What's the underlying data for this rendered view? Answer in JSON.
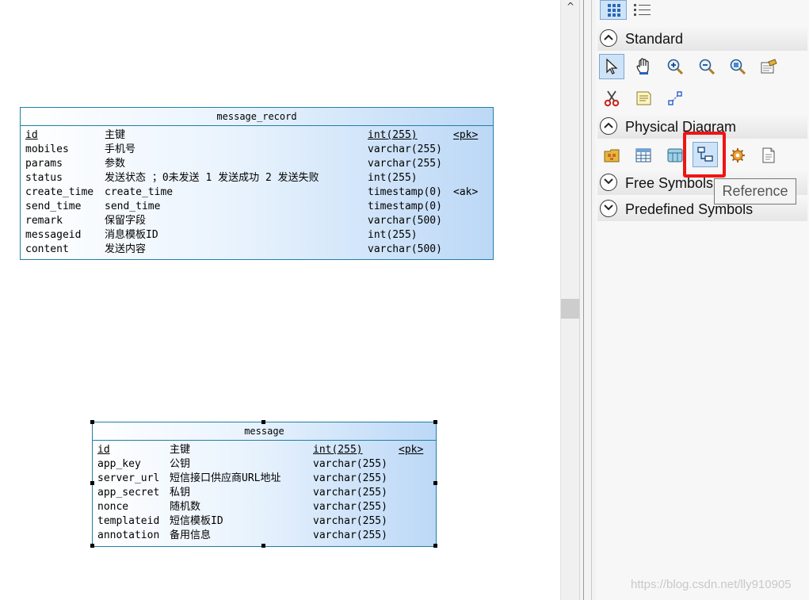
{
  "entities": {
    "message_record": {
      "title": "message_record",
      "rows": [
        {
          "name": "id",
          "comment": "主键",
          "type": "int(255)",
          "key": "<pk>"
        },
        {
          "name": "mobiles",
          "comment": "手机号",
          "type": "varchar(255)",
          "key": ""
        },
        {
          "name": "params",
          "comment": "参数",
          "type": "varchar(255)",
          "key": ""
        },
        {
          "name": "status",
          "comment": "发送状态 ；0未发送 1 发送成功 2 发送失败",
          "type": "int(255)",
          "key": ""
        },
        {
          "name": "create_time",
          "comment": "create_time",
          "type": "timestamp(0)",
          "key": "<ak>"
        },
        {
          "name": "send_time",
          "comment": "send_time",
          "type": "timestamp(0)",
          "key": ""
        },
        {
          "name": "remark",
          "comment": "保留字段",
          "type": "varchar(500)",
          "key": ""
        },
        {
          "name": "messageid",
          "comment": "消息模板ID",
          "type": "int(255)",
          "key": ""
        },
        {
          "name": "content",
          "comment": "发送内容",
          "type": "varchar(500)",
          "key": ""
        }
      ]
    },
    "message": {
      "title": "message",
      "rows": [
        {
          "name": "id",
          "comment": "主键",
          "type": "int(255)",
          "key": "<pk>"
        },
        {
          "name": "app_key",
          "comment": "公钥",
          "type": "varchar(255)",
          "key": ""
        },
        {
          "name": "server_url",
          "comment": "短信接口供应商URL地址",
          "type": "varchar(255)",
          "key": ""
        },
        {
          "name": "app_secret",
          "comment": "私钥",
          "type": "varchar(255)",
          "key": ""
        },
        {
          "name": "nonce",
          "comment": "随机数",
          "type": "varchar(255)",
          "key": ""
        },
        {
          "name": "templateid",
          "comment": "短信模板ID",
          "type": "varchar(255)",
          "key": ""
        },
        {
          "name": "annotation",
          "comment": "备用信息",
          "type": "varchar(255)",
          "key": ""
        }
      ]
    }
  },
  "toolbox": {
    "sections": {
      "standard": "Standard",
      "physical": "Physical Diagram",
      "free": "Free Symbols",
      "predefined": "Predefined Symbols"
    },
    "standard_tools": [
      "pointer-icon",
      "hand-icon",
      "zoom-in-icon",
      "zoom-out-icon",
      "zoom-fit-icon",
      "properties-icon",
      "cut-icon",
      "note-icon",
      "link-icon"
    ],
    "physical_tools": [
      "package-icon",
      "table-icon",
      "view-icon",
      "reference-icon",
      "procedure-icon",
      "file-icon"
    ],
    "tooltip": "Reference"
  },
  "scroll": {
    "up_arrow": "^"
  },
  "watermark": "https://blog.csdn.net/lly910905",
  "colors": {
    "entity_border": "#1f7fa8",
    "gradient_end": "#bcd8f6",
    "highlight": "#f01414"
  }
}
